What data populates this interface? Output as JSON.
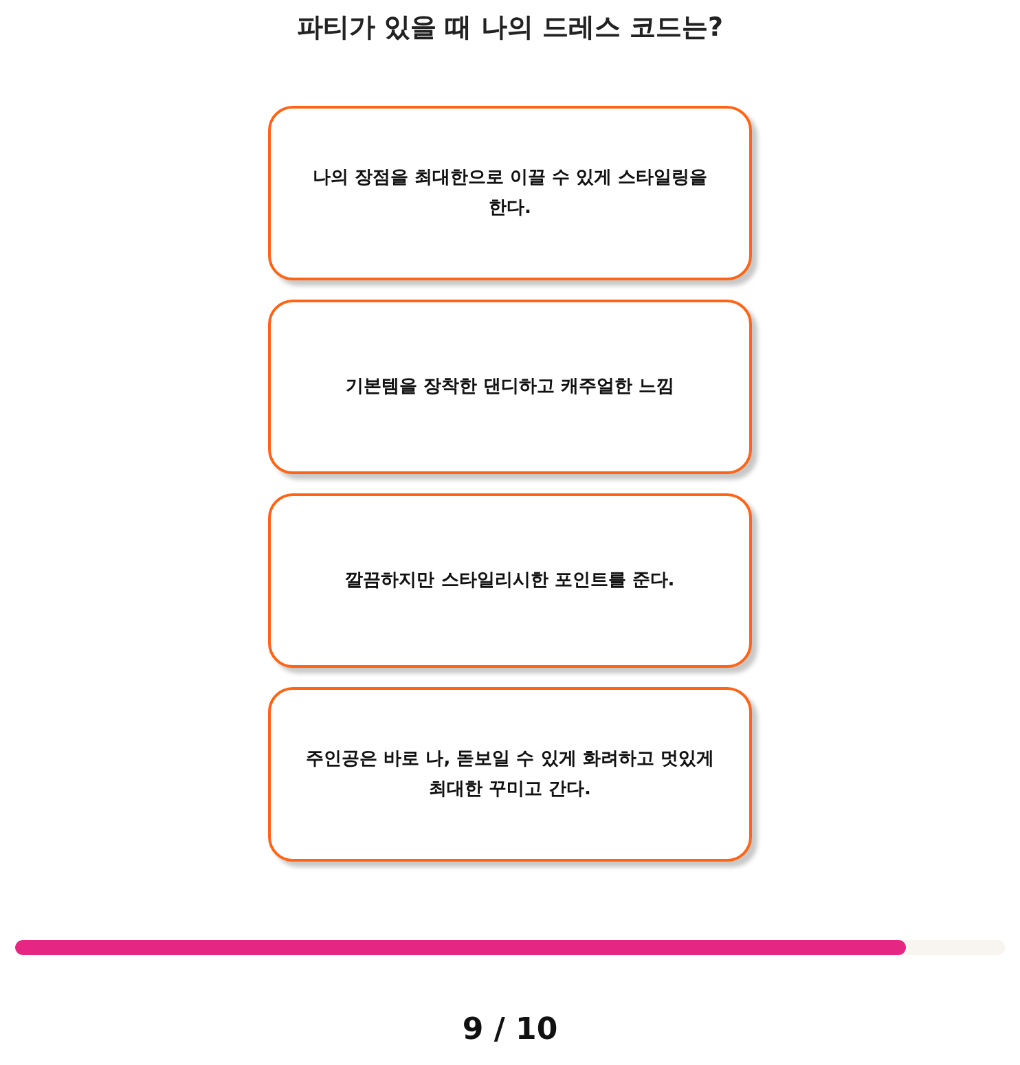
{
  "question": "파티가 있을 때 나의 드레스 코드는?",
  "answers": [
    {
      "label": "나의 장점을 최대한으로 이끌 수 있게 스타일링을 한다.",
      "selected": false
    },
    {
      "label": "기본템을 장착한 댄디하고 캐주얼한 느낌",
      "selected": false
    },
    {
      "label": "깔끔하지만 스타일리시한 포인트를 준다.",
      "selected": false
    },
    {
      "label": "주인공은 바로 나, 돋보일 수 있게 화려하고 멋있게 최대한 꾸미고 간다.",
      "selected": false
    }
  ],
  "progress": {
    "level": 0.9,
    "counter": "9 / 10"
  }
}
